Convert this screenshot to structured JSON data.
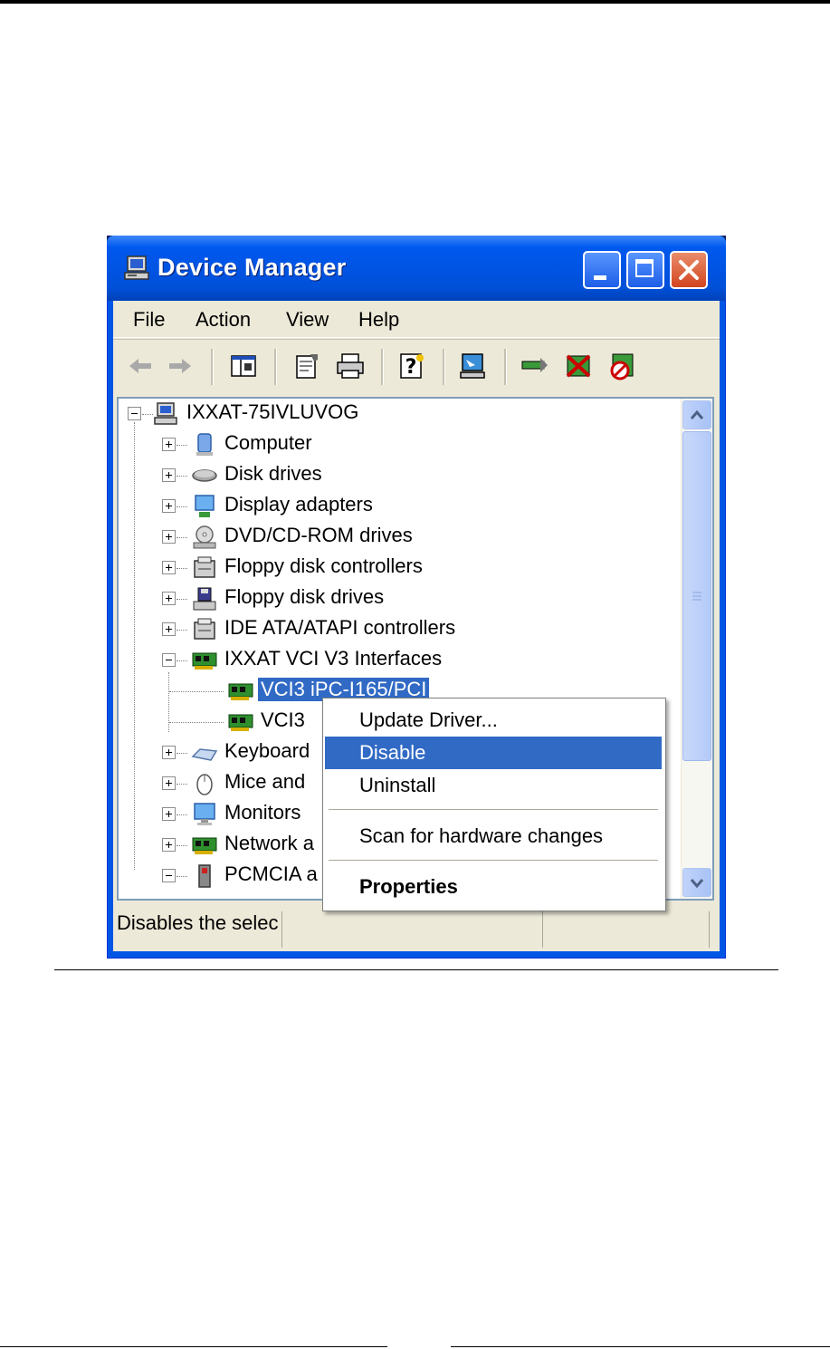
{
  "window": {
    "title": "Device Manager",
    "title_icon": "computer-icon"
  },
  "menu": [
    "File",
    "Action",
    "View",
    "Help"
  ],
  "toolbar": {
    "buttons": [
      "back-arrow-icon",
      "forward-arrow-icon",
      "show-hide-console-tree-icon",
      "properties-icon",
      "print-icon",
      "help-icon",
      "scan-hardware-icon",
      "update-driver-icon",
      "uninstall-icon",
      "disable-icon"
    ]
  },
  "tree": {
    "root": "IXXAT-75IVLUVOG",
    "items": [
      {
        "label": "Computer",
        "icon": "computer-icon",
        "expanded": false
      },
      {
        "label": "Disk drives",
        "icon": "disk-drive-icon",
        "expanded": false
      },
      {
        "label": "Display adapters",
        "icon": "display-adapter-icon",
        "expanded": false
      },
      {
        "label": "DVD/CD-ROM drives",
        "icon": "cdrom-icon",
        "expanded": false
      },
      {
        "label": "Floppy disk controllers",
        "icon": "controller-icon",
        "expanded": false
      },
      {
        "label": "Floppy disk drives",
        "icon": "floppy-drive-icon",
        "expanded": false
      },
      {
        "label": "IDE ATA/ATAPI controllers",
        "icon": "controller-icon",
        "expanded": false
      },
      {
        "label": "IXXAT VCI V3 Interfaces",
        "icon": "network-card-icon",
        "expanded": true
      },
      {
        "label": "VCI3 iPC-I165/PCI",
        "icon": "network-card-icon",
        "child": true,
        "selected": true
      },
      {
        "label": "VCI3",
        "icon": "network-card-icon",
        "child": true,
        "selected": false
      },
      {
        "label": "Keyboard",
        "icon": "keyboard-icon",
        "expanded": false
      },
      {
        "label": "Mice and",
        "icon": "mouse-icon",
        "expanded": false
      },
      {
        "label": "Monitors",
        "icon": "monitor-icon",
        "expanded": false
      },
      {
        "label": "Network a",
        "icon": "network-card-icon",
        "expanded": false
      },
      {
        "label": "PCMCIA a",
        "icon": "pcmcia-icon",
        "expanded": true
      }
    ]
  },
  "context_menu": {
    "items": [
      {
        "label": "Update Driver...",
        "highlighted": false,
        "bold": false
      },
      {
        "label": "Disable",
        "highlighted": true,
        "bold": false
      },
      {
        "label": "Uninstall",
        "highlighted": false,
        "bold": false
      },
      {
        "label": "Scan for hardware changes",
        "highlighted": false,
        "bold": false
      },
      {
        "label": "Properties",
        "highlighted": false,
        "bold": true
      }
    ]
  },
  "status": {
    "text": "Disables the selec"
  },
  "colors": {
    "titlebar": "#0054e3",
    "selection": "#316ac5",
    "face": "#ece9d8"
  }
}
